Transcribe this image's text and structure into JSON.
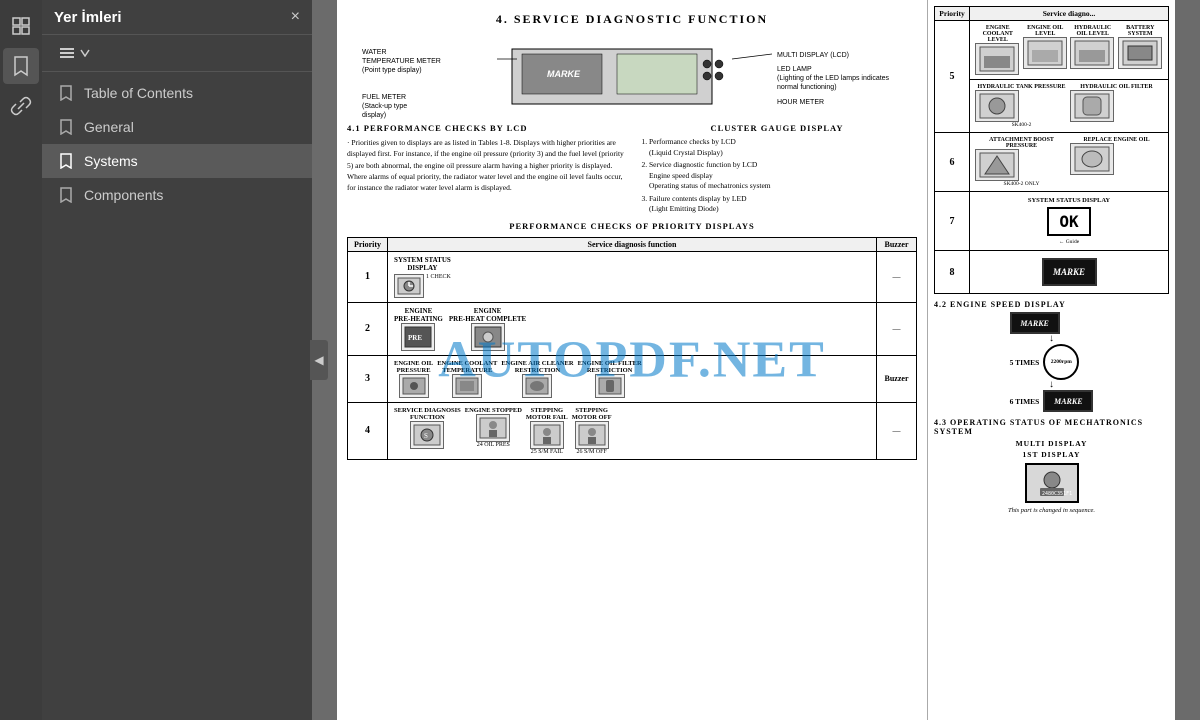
{
  "app": {
    "title": "AUTOPDF.NET",
    "watermark": "AUTOPDF.NET"
  },
  "sidebar": {
    "title": "Yer İmleri",
    "close_label": "×",
    "toolbar_icon": "☰",
    "toolbar_dropdown": "▾",
    "items": [
      {
        "id": "table-of-contents",
        "label": "Table of Contents",
        "active": false
      },
      {
        "id": "general",
        "label": "General",
        "active": false
      },
      {
        "id": "systems",
        "label": "Systems",
        "active": true
      },
      {
        "id": "components",
        "label": "Components",
        "active": false
      }
    ],
    "collapse_arrow": "◀"
  },
  "toolbar_icons": [
    {
      "id": "pages",
      "symbol": "⊞",
      "active": false
    },
    {
      "id": "bookmarks",
      "symbol": "🔖",
      "active": true
    },
    {
      "id": "links",
      "symbol": "🔗",
      "active": false
    }
  ],
  "pdf": {
    "heading": "4.   SERVICE DIAGNOSTIC FUNCTION",
    "diagram_labels": {
      "water_temp": "WATER TEMPERATURE METER (Point type display)",
      "multi_display": "MULTI DISPLAY (LCD)",
      "fuel_meter": "FUEL METER (Stack-up type display)",
      "led_lamp": "LED LAMP (Lighting of the LED lamps indicates normal functioning)",
      "hour_meter": "HOUR METER"
    },
    "section_41": {
      "title": "4.1 PERFORMANCE CHECKS BY LCD",
      "text": "Priorities given to displays are as listed in Tables 1-8. Displays with higher priorities are displayed first. For instance, if the engine oil pressure (priority 3) and the fuel level (priority 5) are both abnormal, the engine oil pressure alarm having a higher priority is displayed. Where alarms of equal priority, the radiator water level and the engine oil level faults occur, for instance the radiator water level alarm is displayed.",
      "cluster_title": "CLUSTER GAUGE DISPLAY",
      "cluster_items": [
        "1) Performance checks by LCD (Liquid Crystal Display)",
        "2) Service diagnostic function by LCD Engine speed display Operating status of mechatronics system",
        "3) Failure contents display by LED (Light Emitting Diode)"
      ]
    },
    "priority_section_title": "PERFORMANCE CHECKS OF PRIORITY DISPLAYS",
    "priority_table": {
      "headers": [
        "Priority",
        "Service diagnosis function",
        "Buzzer"
      ],
      "rows": [
        {
          "priority": "1",
          "items": [
            {
              "name": "SYSTEM STATUS DISPLAY",
              "sub": "1 CHECK"
            }
          ],
          "buzzer": "—"
        },
        {
          "priority": "2",
          "items": [
            {
              "name": "ENGINE PRE-HEATING",
              "sub": ""
            },
            {
              "name": "ENGINE PRE-HEAT COMPLETE",
              "sub": ""
            }
          ],
          "buzzer": "—"
        },
        {
          "priority": "3",
          "items": [
            {
              "name": "ENGINE OIL PRESSURE",
              "sub": ""
            },
            {
              "name": "ENGINE COOLANT TEMPERATURE",
              "sub": ""
            },
            {
              "name": "ENGINE AIR CLEANER RESTRICTION",
              "sub": ""
            },
            {
              "name": "ENGINE OIL FILTER RESTRICTION",
              "sub": ""
            }
          ],
          "buzzer": "Buzzer"
        },
        {
          "priority": "4",
          "items": [
            {
              "name": "SERVICE DIAGNOSIS FUNCTION",
              "sub": ""
            },
            {
              "name": "ENGINE STOPPED",
              "sub": "24 OIL PRES"
            },
            {
              "name": "STEPPING MOTOR FAIL",
              "sub": "25 S/M FAIL"
            },
            {
              "name": "STEPPING MOTOR OFF",
              "sub": "26 S/M OFF"
            }
          ],
          "buzzer": "—"
        }
      ]
    }
  },
  "right_panel": {
    "table_headers": [
      "Priority",
      "Service diagnosis"
    ],
    "rows": [
      {
        "priority": "5",
        "items": [
          {
            "label": "ENGINE COOLANT LEVEL",
            "sub": ""
          },
          {
            "label": "ENGINE OIL LEVEL",
            "sub": ""
          },
          {
            "label": "HYDRAULIC OIL LEVEL",
            "sub": ""
          },
          {
            "label": "BATTERY SYSTEM",
            "sub": ""
          }
        ]
      },
      {
        "priority": "5",
        "items": [
          {
            "label": "HYDRAULIC TANK PRESSURE",
            "sub": ""
          },
          {
            "label": "HYDRAULIC OIL FILTER",
            "sub": ""
          }
        ]
      },
      {
        "priority": "6",
        "items": [
          {
            "label": "ATTACHMENT BOOST PRESSURE",
            "sub": "SK400-2 ONLY"
          },
          {
            "label": "REPLACE ENGINE OIL",
            "sub": ""
          }
        ]
      },
      {
        "priority": "7",
        "items": [
          {
            "label": "SYSTEM STATUS DISPLAY",
            "sub": ""
          }
        ],
        "special": "OK"
      },
      {
        "priority": "8",
        "items": [
          {
            "label": "MARKE DISPLAY",
            "sub": ""
          }
        ]
      }
    ],
    "section_42_title": "4.2 ENGINE SPEED DISPLAY",
    "engine_speed": {
      "times_5": "5 TIMES",
      "times_6": "6 TIMES",
      "rpm_label": "2200rpm"
    },
    "section_43_title": "4.3 OPERATING STATUS OF MECHATRONICS SYSTEM",
    "multi_display_label": "MULTI DISPLAY",
    "first_display_label": "1ST DISPLAY",
    "first_display_code": "2480C351F1",
    "note": "This part is changed in sequence."
  }
}
